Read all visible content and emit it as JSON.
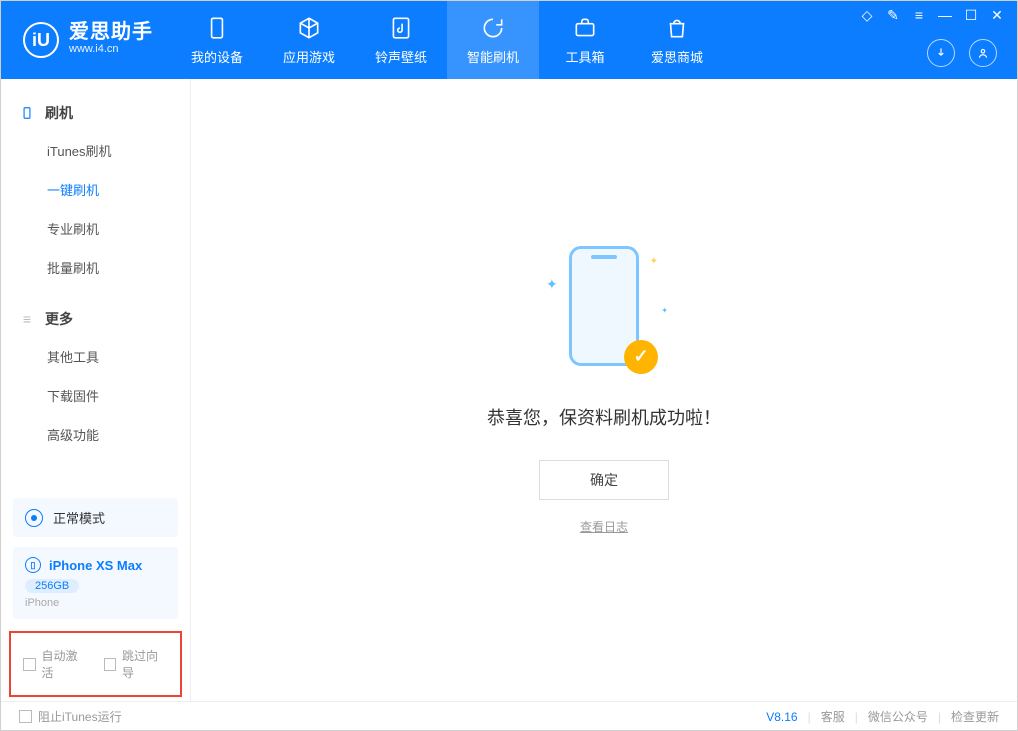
{
  "app": {
    "name_cn": "爱思助手",
    "name_en": "www.i4.cn"
  },
  "nav": {
    "items": [
      {
        "label": "我的设备"
      },
      {
        "label": "应用游戏"
      },
      {
        "label": "铃声壁纸"
      },
      {
        "label": "智能刷机"
      },
      {
        "label": "工具箱"
      },
      {
        "label": "爱思商城"
      }
    ]
  },
  "sidebar": {
    "group1_title": "刷机",
    "group1_items": [
      {
        "label": "iTunes刷机"
      },
      {
        "label": "一键刷机"
      },
      {
        "label": "专业刷机"
      },
      {
        "label": "批量刷机"
      }
    ],
    "group2_title": "更多",
    "group2_items": [
      {
        "label": "其他工具"
      },
      {
        "label": "下载固件"
      },
      {
        "label": "高级功能"
      }
    ],
    "mode_label": "正常模式",
    "device": {
      "name": "iPhone XS Max",
      "storage": "256GB",
      "type": "iPhone"
    },
    "checkbox_auto_activate": "自动激活",
    "checkbox_skip_guide": "跳过向导"
  },
  "main": {
    "success_text": "恭喜您，保资料刷机成功啦！",
    "ok_button": "确定",
    "view_log": "查看日志"
  },
  "footer": {
    "block_itunes": "阻止iTunes运行",
    "version": "V8.16",
    "links": [
      "客服",
      "微信公众号",
      "检查更新"
    ]
  }
}
